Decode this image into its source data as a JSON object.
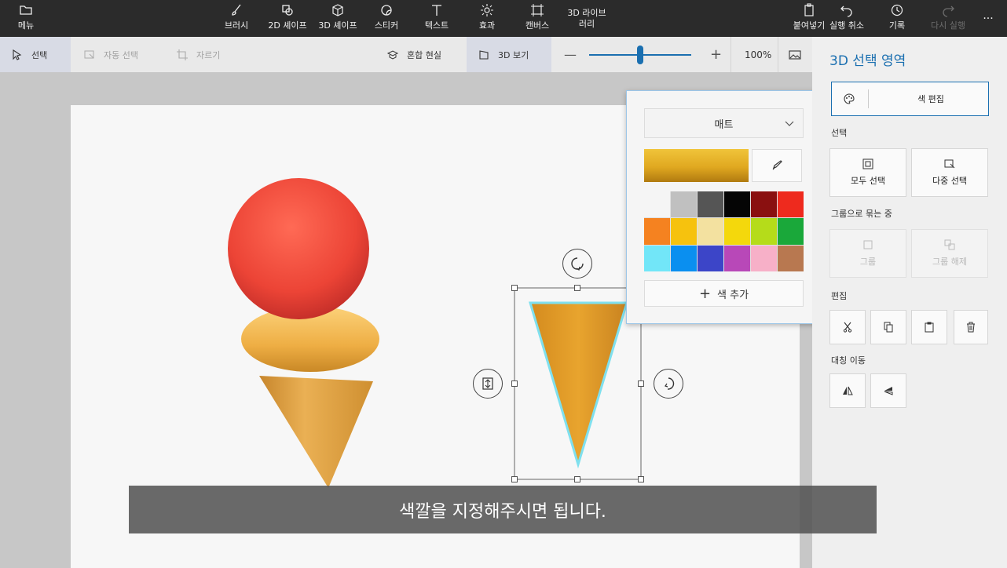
{
  "topbar": {
    "menu": "메뉴",
    "tools": [
      {
        "label": "브러시",
        "icon": "brush-icon"
      },
      {
        "label": "2D 셰이프",
        "icon": "shapes-2d-icon"
      },
      {
        "label": "3D 셰이프",
        "icon": "cube-icon"
      },
      {
        "label": "스티커",
        "icon": "sticker-icon"
      },
      {
        "label": "텍스트",
        "icon": "text-icon"
      },
      {
        "label": "효과",
        "icon": "sun-icon"
      },
      {
        "label": "캔버스",
        "icon": "canvas-icon"
      },
      {
        "label": "3D 라이브\n러리",
        "icon": "library-icon"
      }
    ],
    "paste": "붙여넣기",
    "undo": "실행 취소",
    "history": "기록",
    "redo": "다시 실행",
    "more": "..."
  },
  "subbar": {
    "select": "선택",
    "magic_select": "자동 선택",
    "crop": "자르기",
    "mixed_reality": "혼합 현실",
    "view_3d": "3D 보기",
    "zoom_out": "—",
    "zoom_in": "+",
    "zoom": "100%",
    "zoom_level": 0.5
  },
  "panel": {
    "title": "3D 선택 영역",
    "edit_color": "색 편집",
    "section_select": "선택",
    "select_all": "모두 선택",
    "multi_select": "다중 선택",
    "section_group": "그룹으로 묶는 중",
    "group": "그룹",
    "ungroup": "그룹 해제",
    "section_edit": "편집",
    "section_flip": "대칭 이동"
  },
  "popup": {
    "material": "매트",
    "add_color": "색 추가",
    "current_color": "#e0a820",
    "palette": [
      "#f5f5f5",
      "#c0c0c0",
      "#555555",
      "#050505",
      "#8a1010",
      "#ee2a1e",
      "#f58220",
      "#f6c20e",
      "#f3e1a0",
      "#f4d80c",
      "#b5dc1a",
      "#1aa83a",
      "#72e6f8",
      "#0a8ff0",
      "#3c45c8",
      "#b848b8",
      "#f7b0c8",
      "#b87850"
    ]
  },
  "subtitle": "색깔을 지정해주시면 됩니다.",
  "colors": {
    "ball": "#f0483a",
    "cone": "#e2a233",
    "cream": "#f0b44a",
    "accent": "#1a6fb0",
    "selection_glow": "#7fe0ee"
  }
}
